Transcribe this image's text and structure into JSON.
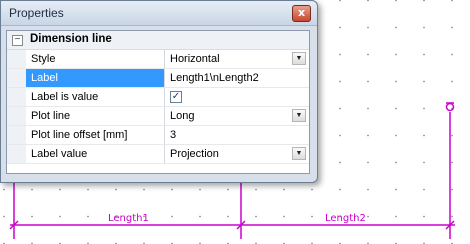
{
  "window": {
    "title": "Properties",
    "close_glyph": "x"
  },
  "category": {
    "label": "Dimension line",
    "collapse_glyph": "−"
  },
  "properties": [
    {
      "name": "Style",
      "value": "Horizontal",
      "type": "dropdown"
    },
    {
      "name": "Label",
      "value": "Length1\\nLength2",
      "type": "text",
      "selected": true
    },
    {
      "name": "Label is value",
      "value": "✓",
      "type": "checkbox",
      "checked": true
    },
    {
      "name": "Plot line",
      "value": "Long",
      "type": "dropdown"
    },
    {
      "name": "Plot line offset [mm]",
      "value": "3",
      "type": "text"
    },
    {
      "name": "Label value",
      "value": "Projection",
      "type": "dropdown"
    }
  ],
  "dropdown_glyph": "▼",
  "drawing": {
    "dimension_labels": [
      "Length1",
      "Length2"
    ],
    "line_color": "#cc00cc"
  },
  "colors": {
    "selection": "#3399ff",
    "close_button": "#c5482d",
    "window_bg": "#d7dfea"
  }
}
